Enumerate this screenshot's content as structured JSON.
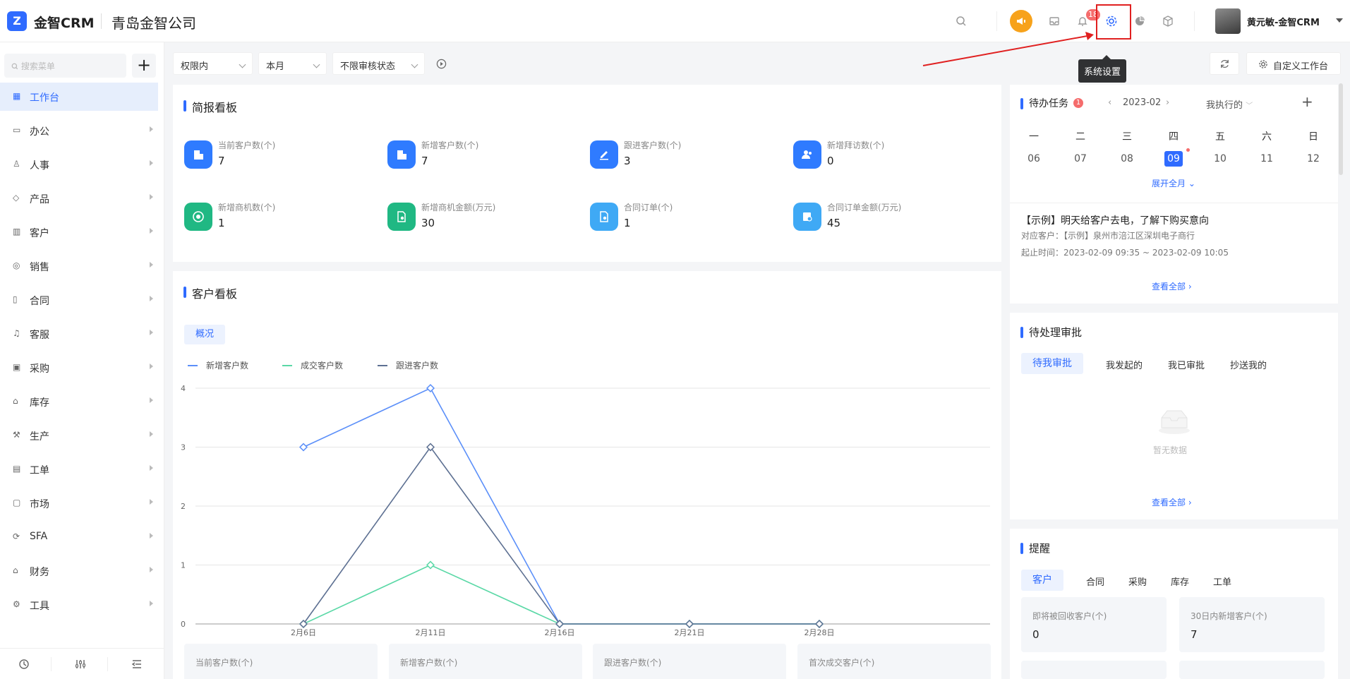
{
  "header": {
    "brand": "金智CRM",
    "company": "青岛金智公司",
    "notification_count": "18",
    "tooltip": "系统设置",
    "user": "黄元敏-金智CRM",
    "icons": [
      "search-icon",
      "megaphone-icon",
      "inbox-icon",
      "bell-icon",
      "gear-icon",
      "pie-chart-icon",
      "cube-icon"
    ]
  },
  "sidebar": {
    "search_placeholder": "搜索菜单",
    "add": "+",
    "items": [
      {
        "label": "工作台",
        "icon": "dashboard-icon",
        "active": true
      },
      {
        "label": "办公",
        "icon": "office-icon"
      },
      {
        "label": "人事",
        "icon": "people-icon"
      },
      {
        "label": "产品",
        "icon": "box-icon"
      },
      {
        "label": "客户",
        "icon": "customer-icon"
      },
      {
        "label": "销售",
        "icon": "sales-icon"
      },
      {
        "label": "合同",
        "icon": "contract-icon"
      },
      {
        "label": "客服",
        "icon": "headset-icon"
      },
      {
        "label": "采购",
        "icon": "purchase-icon"
      },
      {
        "label": "库存",
        "icon": "warehouse-icon"
      },
      {
        "label": "生产",
        "icon": "factory-icon"
      },
      {
        "label": "工单",
        "icon": "ticket-icon"
      },
      {
        "label": "市场",
        "icon": "market-icon"
      },
      {
        "label": "SFA",
        "icon": "sfa-icon"
      },
      {
        "label": "财务",
        "icon": "finance-icon"
      },
      {
        "label": "工具",
        "icon": "tools-icon"
      }
    ]
  },
  "filters": {
    "scope": "权限内",
    "period": "本月",
    "audit": "不限审核状态",
    "custom_workspace": "自定义工作台"
  },
  "brief": {
    "title": "简报看板",
    "stats": [
      {
        "label": "当前客户数(个)",
        "value": "7",
        "color": "#2f7bff"
      },
      {
        "label": "新增客户数(个)",
        "value": "7",
        "color": "#2f7bff"
      },
      {
        "label": "跟进客户数(个)",
        "value": "3",
        "color": "#2f7bff"
      },
      {
        "label": "新增拜访数(个)",
        "value": "0",
        "color": "#2f7bff"
      },
      {
        "label": "新增商机数(个)",
        "value": "1",
        "color": "#20b883"
      },
      {
        "label": "新增商机金额(万元)",
        "value": "30",
        "color": "#20b883"
      },
      {
        "label": "合同订单(个)",
        "value": "1",
        "color": "#3fa9f5"
      },
      {
        "label": "合同订单金额(万元)",
        "value": "45",
        "color": "#3fa9f5"
      }
    ]
  },
  "customer_board": {
    "title": "客户看板",
    "tab": "概况",
    "bottom_cards": [
      "当前客户数(个)",
      "新增客户数(个)",
      "跟进客户数(个)",
      "首次成交客户(个)"
    ]
  },
  "chart_data": {
    "type": "line",
    "x": [
      "2月6日",
      "2月11日",
      "2月16日",
      "2月21日",
      "2月28日"
    ],
    "ylim": [
      0,
      4
    ],
    "yticks": [
      "0",
      "1",
      "2",
      "3",
      "4"
    ],
    "series": [
      {
        "name": "新增客户数",
        "color": "#5b8ff9",
        "values": [
          3,
          4,
          0,
          0,
          0
        ]
      },
      {
        "name": "成交客户数",
        "color": "#5ad8a6",
        "values": [
          0,
          1,
          0,
          0,
          0
        ]
      },
      {
        "name": "跟进客户数",
        "color": "#5d7092",
        "values": [
          0,
          3,
          0,
          0,
          0
        ]
      }
    ]
  },
  "tasks": {
    "title": "待办任务",
    "badge": "1",
    "month": "2023-02",
    "filter": "我执行的",
    "weekdays": [
      "一",
      "二",
      "三",
      "四",
      "五",
      "六",
      "日"
    ],
    "days": [
      "06",
      "07",
      "08",
      "09",
      "10",
      "11",
      "12"
    ],
    "selected_day": "09",
    "expand": "展开全月",
    "item_title": "【示例】明天给客户去电，了解下购买意向",
    "item_customer": "对应客户：【示例】泉州市涪江区深圳电子商行",
    "item_time": "起止时间：2023-02-09 09:35 ~ 2023-02-09 10:05",
    "view_all": "查看全部"
  },
  "approval": {
    "title": "待处理审批",
    "tabs": [
      "待我审批",
      "我发起的",
      "我已审批",
      "抄送我的"
    ],
    "empty": "暂无数据",
    "view_all": "查看全部"
  },
  "reminder": {
    "title": "提醒",
    "tabs": [
      "客户",
      "合同",
      "采购",
      "库存",
      "工单"
    ],
    "cards": [
      {
        "label": "即将被回收客户(个)",
        "value": "0"
      },
      {
        "label": "30日内新增客户(个)",
        "value": "7"
      }
    ]
  }
}
